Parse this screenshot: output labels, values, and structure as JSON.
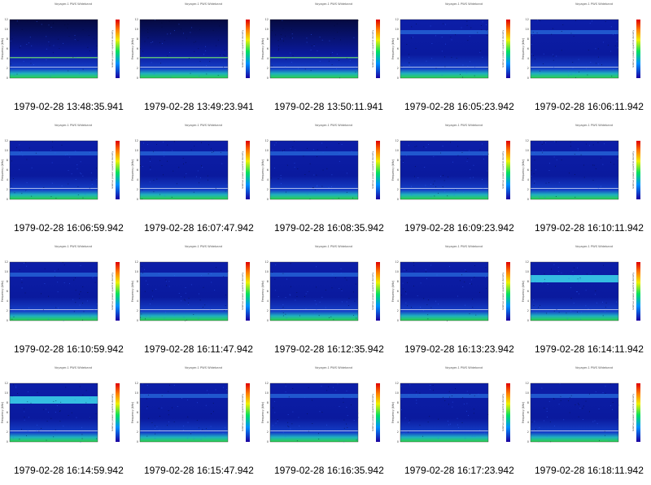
{
  "panel_title": "Voyager-1 PWS Wideband",
  "colorbar_label": "relative power spectral density",
  "y_axis_label": "Frequency (kHz)",
  "y_ticks": [
    "0",
    "2",
    "4",
    "6",
    "8",
    "10",
    "12"
  ],
  "colors": {
    "background": "#ffffff",
    "spectrogram_base": "#0a1a9e",
    "spectrogram_dark": "#050a40",
    "caption": "#000000"
  },
  "panels": [
    {
      "caption": "1979-02-28 13:48:35.941",
      "style": "early"
    },
    {
      "caption": "1979-02-28 13:49:23.941",
      "style": "early"
    },
    {
      "caption": "1979-02-28 13:50:11.941",
      "style": "early"
    },
    {
      "caption": "1979-02-28 16:05:23.942",
      "style": "band"
    },
    {
      "caption": "1979-02-28 16:06:11.942",
      "style": "band"
    },
    {
      "caption": "1979-02-28 16:06:59.942",
      "style": "band"
    },
    {
      "caption": "1979-02-28 16:07:47.942",
      "style": "band"
    },
    {
      "caption": "1979-02-28 16:08:35.942",
      "style": "band"
    },
    {
      "caption": "1979-02-28 16:09:23.942",
      "style": "band"
    },
    {
      "caption": "1979-02-28 16:10:11.942",
      "style": "band"
    },
    {
      "caption": "1979-02-28 16:10:59.942",
      "style": "band"
    },
    {
      "caption": "1979-02-28 16:11:47.942",
      "style": "band"
    },
    {
      "caption": "1979-02-28 16:12:35.942",
      "style": "band"
    },
    {
      "caption": "1979-02-28 16:13:23.942",
      "style": "band"
    },
    {
      "caption": "1979-02-28 16:14:11.942",
      "style": "strong"
    },
    {
      "caption": "1979-02-28 16:14:59.942",
      "style": "strong"
    },
    {
      "caption": "1979-02-28 16:15:47.942",
      "style": "band"
    },
    {
      "caption": "1979-02-28 16:16:35.942",
      "style": "band"
    },
    {
      "caption": "1979-02-28 16:17:23.942",
      "style": "band"
    },
    {
      "caption": "1979-02-28 16:18:11.942",
      "style": "band"
    }
  ]
}
